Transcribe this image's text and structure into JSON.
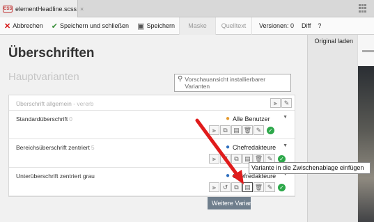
{
  "editor_tab": {
    "filename": "elementHeadline.scss",
    "close": "×",
    "file_icon_text": "CSS"
  },
  "toolbar": {
    "cancel": "Abbrechen",
    "save_close": "Speichern und schließen",
    "save": "Speichern",
    "tab_mask": "Maske",
    "tab_source": "Quelltext",
    "versions": "Versionen: 0",
    "diff": "Diff",
    "help": "?"
  },
  "right_panel": {
    "load_original": "Original laden"
  },
  "main": {
    "title": "Überschriften",
    "subtitle": "Hauptvarianten",
    "search_placeholder": "Vorschauansicht installierbarer Varianten"
  },
  "general_row": {
    "name": "Überschrift allgemein",
    "inherit": " - vererb"
  },
  "variants": [
    {
      "name": "Standardüberschrift",
      "count": "0",
      "user": "Alle Benutzer",
      "user_color": "#e59a2f"
    },
    {
      "name": "Bereichsüberschrift zentriert",
      "count": "5",
      "user": "Chefredakteure",
      "user_color": "#2f6fbf"
    },
    {
      "name": "Unterüberschrift zentriert grau",
      "count": "",
      "user": "Chefredakteure",
      "user_color": "#2f6fbf"
    }
  ],
  "more_button": "Weitere Varianten",
  "tooltip": "Variante in die Zwischenablage einfügen",
  "colors": {
    "accent_red": "#e01b1b",
    "check_green": "#2da84a",
    "button_gray": "#6f7e8c"
  }
}
